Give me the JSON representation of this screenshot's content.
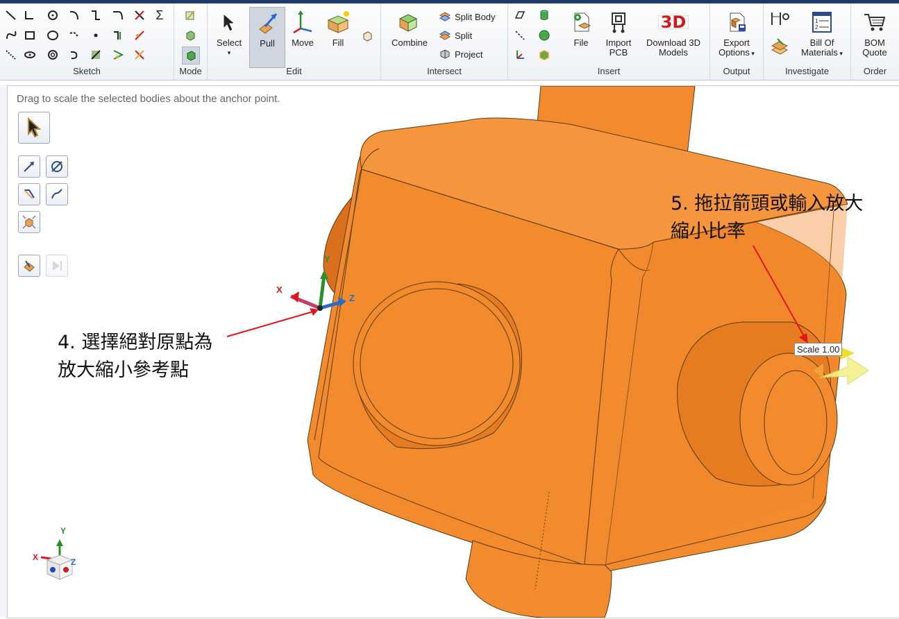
{
  "ribbon": {
    "groups": {
      "sketch": "Sketch",
      "mode": "Mode",
      "edit": "Edit",
      "intersect": "Intersect",
      "insert": "Insert",
      "output": "Output",
      "investigate": "Investigate",
      "order": "Order"
    },
    "edit": {
      "select": "Select",
      "pull": "Pull",
      "move": "Move",
      "fill": "Fill"
    },
    "intersect": {
      "combine": "Combine",
      "split_body": "Split Body",
      "split": "Split",
      "project": "Project"
    },
    "insert": {
      "file": "File",
      "import_pcb_1": "Import",
      "import_pcb_2": "PCB",
      "download_1": "Download 3D",
      "download_2": "Models",
      "download_badge": "3D"
    },
    "output": {
      "export_1": "Export",
      "export_2": "Options"
    },
    "investigate": {
      "bom_1": "Bill Of",
      "bom_2": "Materials"
    },
    "order": {
      "bom_quote_1": "BOM",
      "bom_quote_2": "Quote"
    },
    "sketch_sum": "Σ"
  },
  "canvas": {
    "hint": "Drag to scale the selected bodies about the anchor point.",
    "callout_4_line1": "4. 選擇絕對原點為",
    "callout_4_line2": "放大縮小參考點",
    "callout_5_line1": "5. 拖拉箭頭或輸入放大",
    "callout_5_line2": "縮小比率",
    "scale_label": "Scale 1.00",
    "axis_x": "X",
    "axis_y": "Y",
    "axis_z": "Z"
  },
  "colors": {
    "part": "#f28a2e",
    "part_shadow": "#d8701e",
    "part_edge": "#5a3a10",
    "annotation_arrow": "#e0161b",
    "ribbon_bg": "#eef1f5",
    "title_stripe": "#1f3a6b"
  }
}
